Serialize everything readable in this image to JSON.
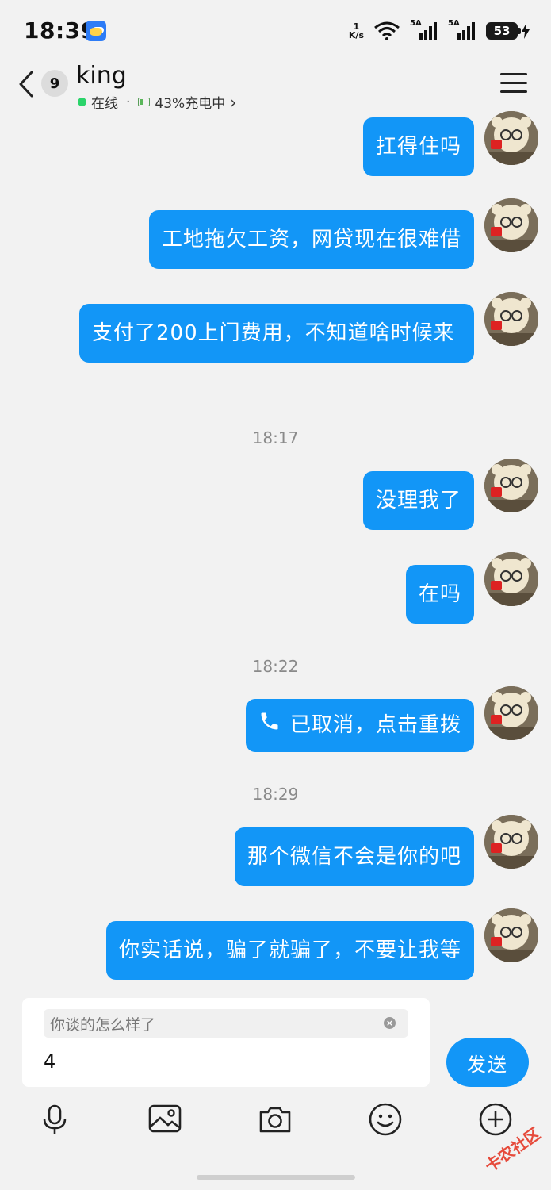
{
  "status_bar": {
    "time": "18:39",
    "net_speed_value": "1",
    "net_speed_unit": "K/s",
    "sim1_tag": "5A",
    "sim2_tag": "5A",
    "battery_level": "53"
  },
  "header": {
    "badge_count": "9",
    "contact_name": "king",
    "online_status": "在线",
    "separator": "·",
    "battery_status": "43%充电中",
    "chevron": "›"
  },
  "messages": [
    {
      "text": "扛得住吗"
    },
    {
      "text": "工地拖欠工资，网贷现在很难借"
    },
    {
      "text": "支付了200上门费用，不知道啥时候来"
    },
    {
      "text": "没理我了"
    },
    {
      "text": "在吗"
    },
    {
      "text": "已取消，点击重拨"
    },
    {
      "text": "那个微信不会是你的吧"
    },
    {
      "text": "你实话说，骗了就骗了，不要让我等"
    }
  ],
  "timestamps": [
    "18:17",
    "18:22",
    "18:29"
  ],
  "composer": {
    "quote_text": "你谈的怎么样了",
    "input_value": "4",
    "send_label": "发送"
  },
  "toolbar": {
    "icons": [
      "microphone-icon",
      "image-icon",
      "camera-icon",
      "emoji-icon",
      "plus-icon"
    ]
  },
  "watermark": "卡农社区",
  "colors": {
    "accent": "#1296f7",
    "background": "#f2f2f2",
    "online": "#2bd46a"
  }
}
